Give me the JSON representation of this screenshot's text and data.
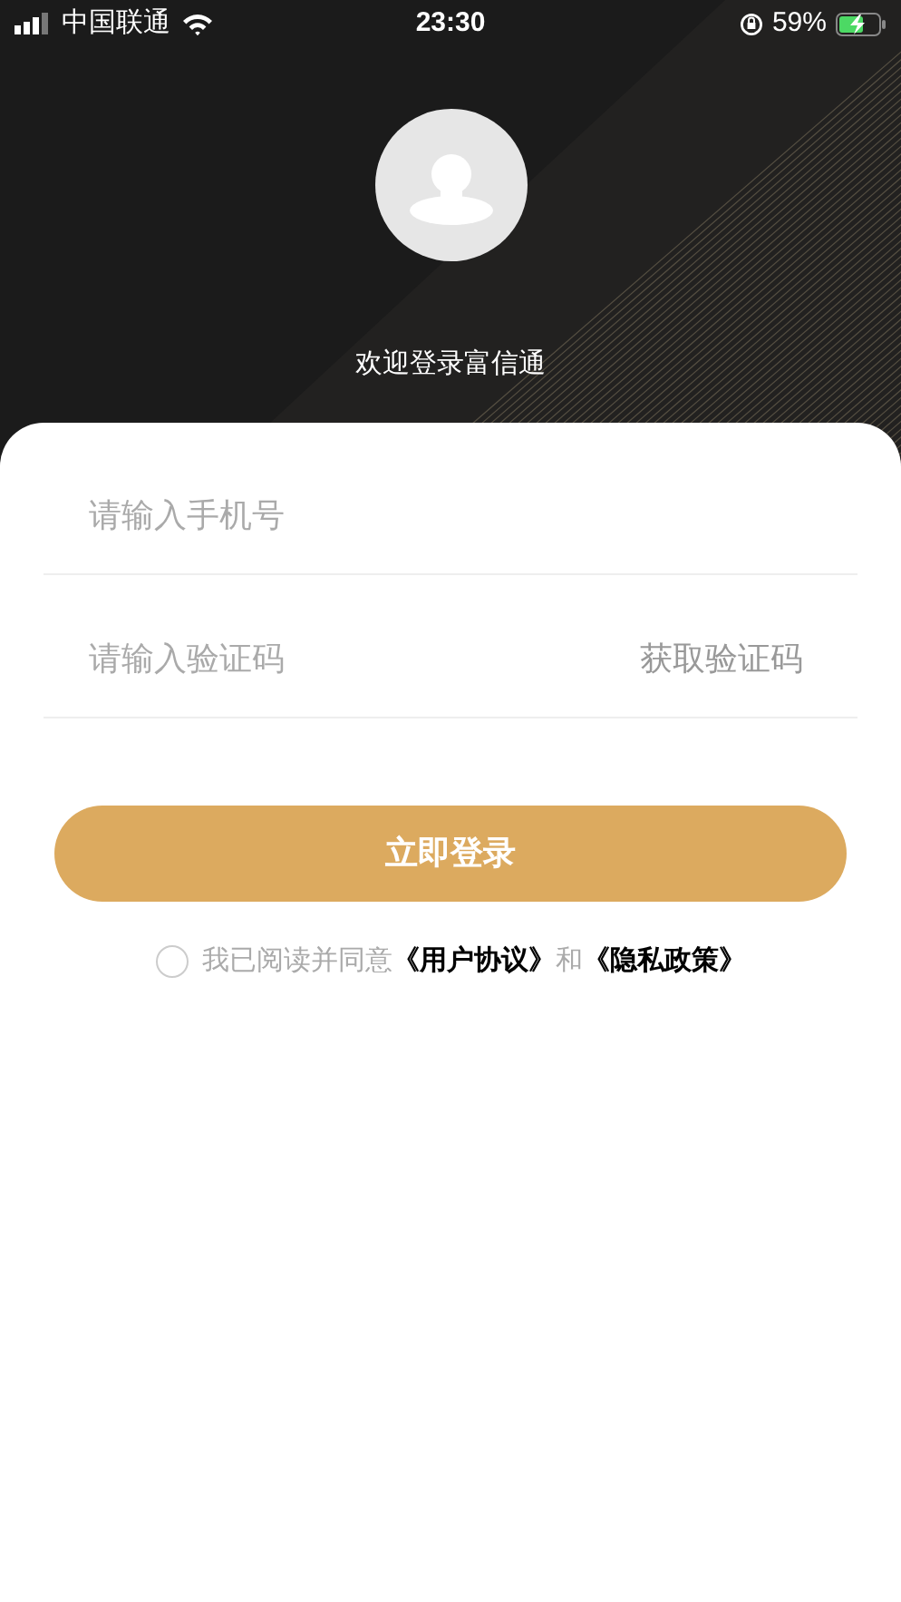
{
  "status_bar": {
    "carrier": "中国联通",
    "time": "23:30",
    "battery_percent": "59%"
  },
  "header": {
    "welcome": "欢迎登录富信通"
  },
  "form": {
    "phone": {
      "placeholder": "请输入手机号"
    },
    "code": {
      "placeholder": "请输入验证码",
      "action": "获取验证码"
    },
    "submit": "立即登录",
    "agreement": {
      "checked": false,
      "prefix": "我已阅读并同意",
      "link_1": "《用户协议》",
      "joiner": "和",
      "link_2": "《隐私政策》"
    }
  }
}
